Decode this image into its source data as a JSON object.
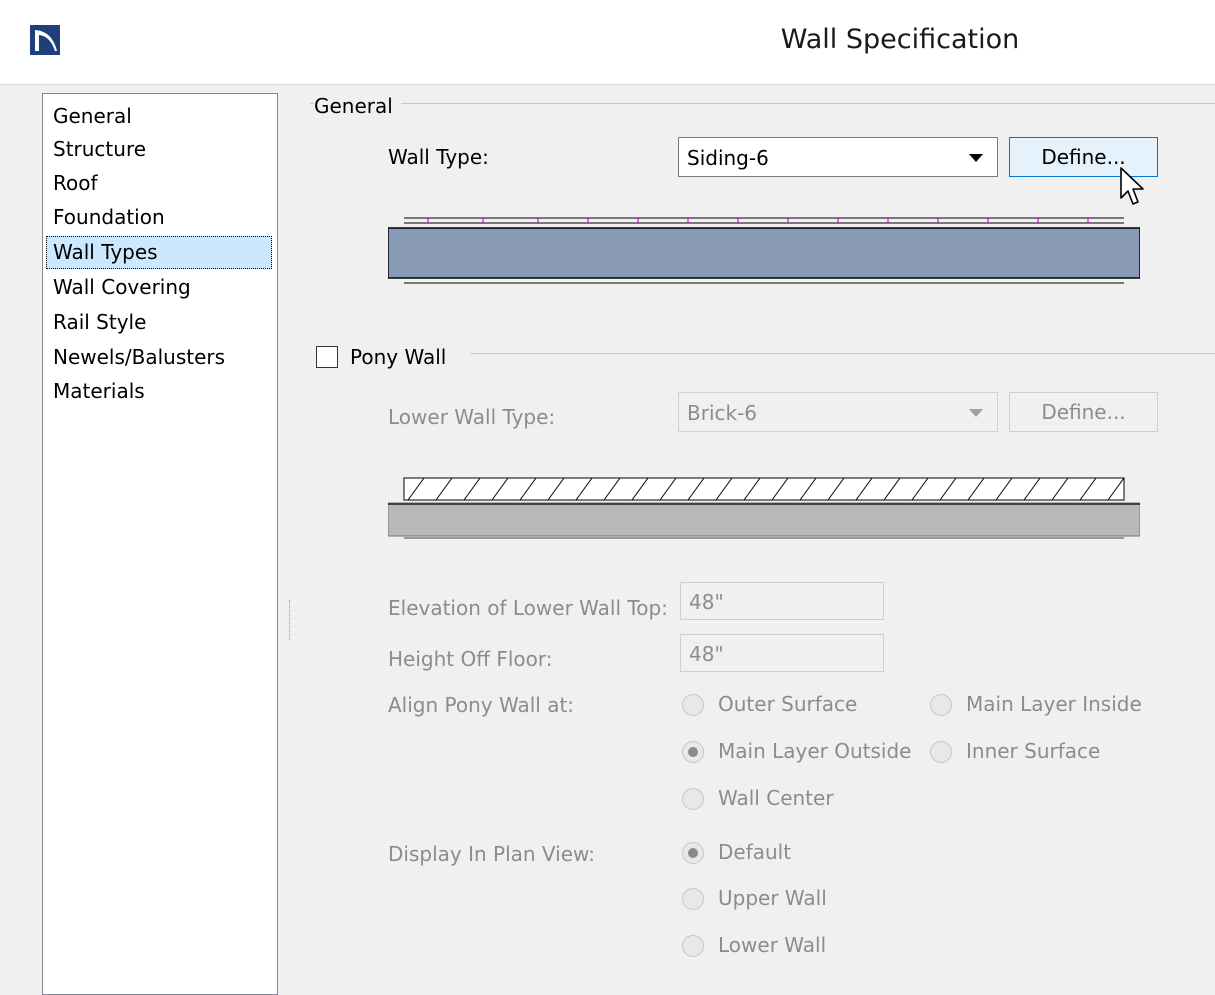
{
  "window": {
    "title": "Wall Specification",
    "icon": "chief-architect-logo-icon"
  },
  "nav": {
    "items": [
      {
        "label": "General"
      },
      {
        "label": "Structure"
      },
      {
        "label": "Roof"
      },
      {
        "label": "Foundation"
      },
      {
        "label": "Wall Types",
        "selected": true
      },
      {
        "label": "Wall Covering"
      },
      {
        "label": "Rail Style"
      },
      {
        "label": "Newels/Balusters"
      },
      {
        "label": "Materials"
      }
    ]
  },
  "general": {
    "group_label": "General",
    "wall_type_label": "Wall Type:",
    "wall_type_value": "Siding-6",
    "define_label": "Define..."
  },
  "pony_wall": {
    "checkbox_label": "Pony Wall",
    "checked": false,
    "lower_wall_type_label": "Lower Wall Type:",
    "lower_wall_type_value": "Brick-6",
    "define_label": "Define...",
    "elevation_label": "Elevation of Lower Wall Top:",
    "elevation_value": "48\"",
    "height_label": "Height Off Floor:",
    "height_value": "48\"",
    "align_label": "Align Pony Wall at:",
    "align_options": {
      "outer_surface": "Outer Surface",
      "main_layer_inside": "Main Layer Inside",
      "main_layer_outside": "Main Layer Outside",
      "inner_surface": "Inner Surface",
      "wall_center": "Wall Center"
    },
    "align_selected": "Main Layer Outside",
    "display_label": "Display In Plan View:",
    "display_options": {
      "default": "Default",
      "upper_wall": "Upper Wall",
      "lower_wall": "Lower Wall"
    },
    "display_selected": "Default"
  },
  "colors": {
    "selection": "#cce8ff",
    "button_focus_border": "#0078d7",
    "siding_main_layer": "#8899b5",
    "brick_main_layer": "#b8b8b8",
    "disabled_text": "#8c8c8c"
  }
}
